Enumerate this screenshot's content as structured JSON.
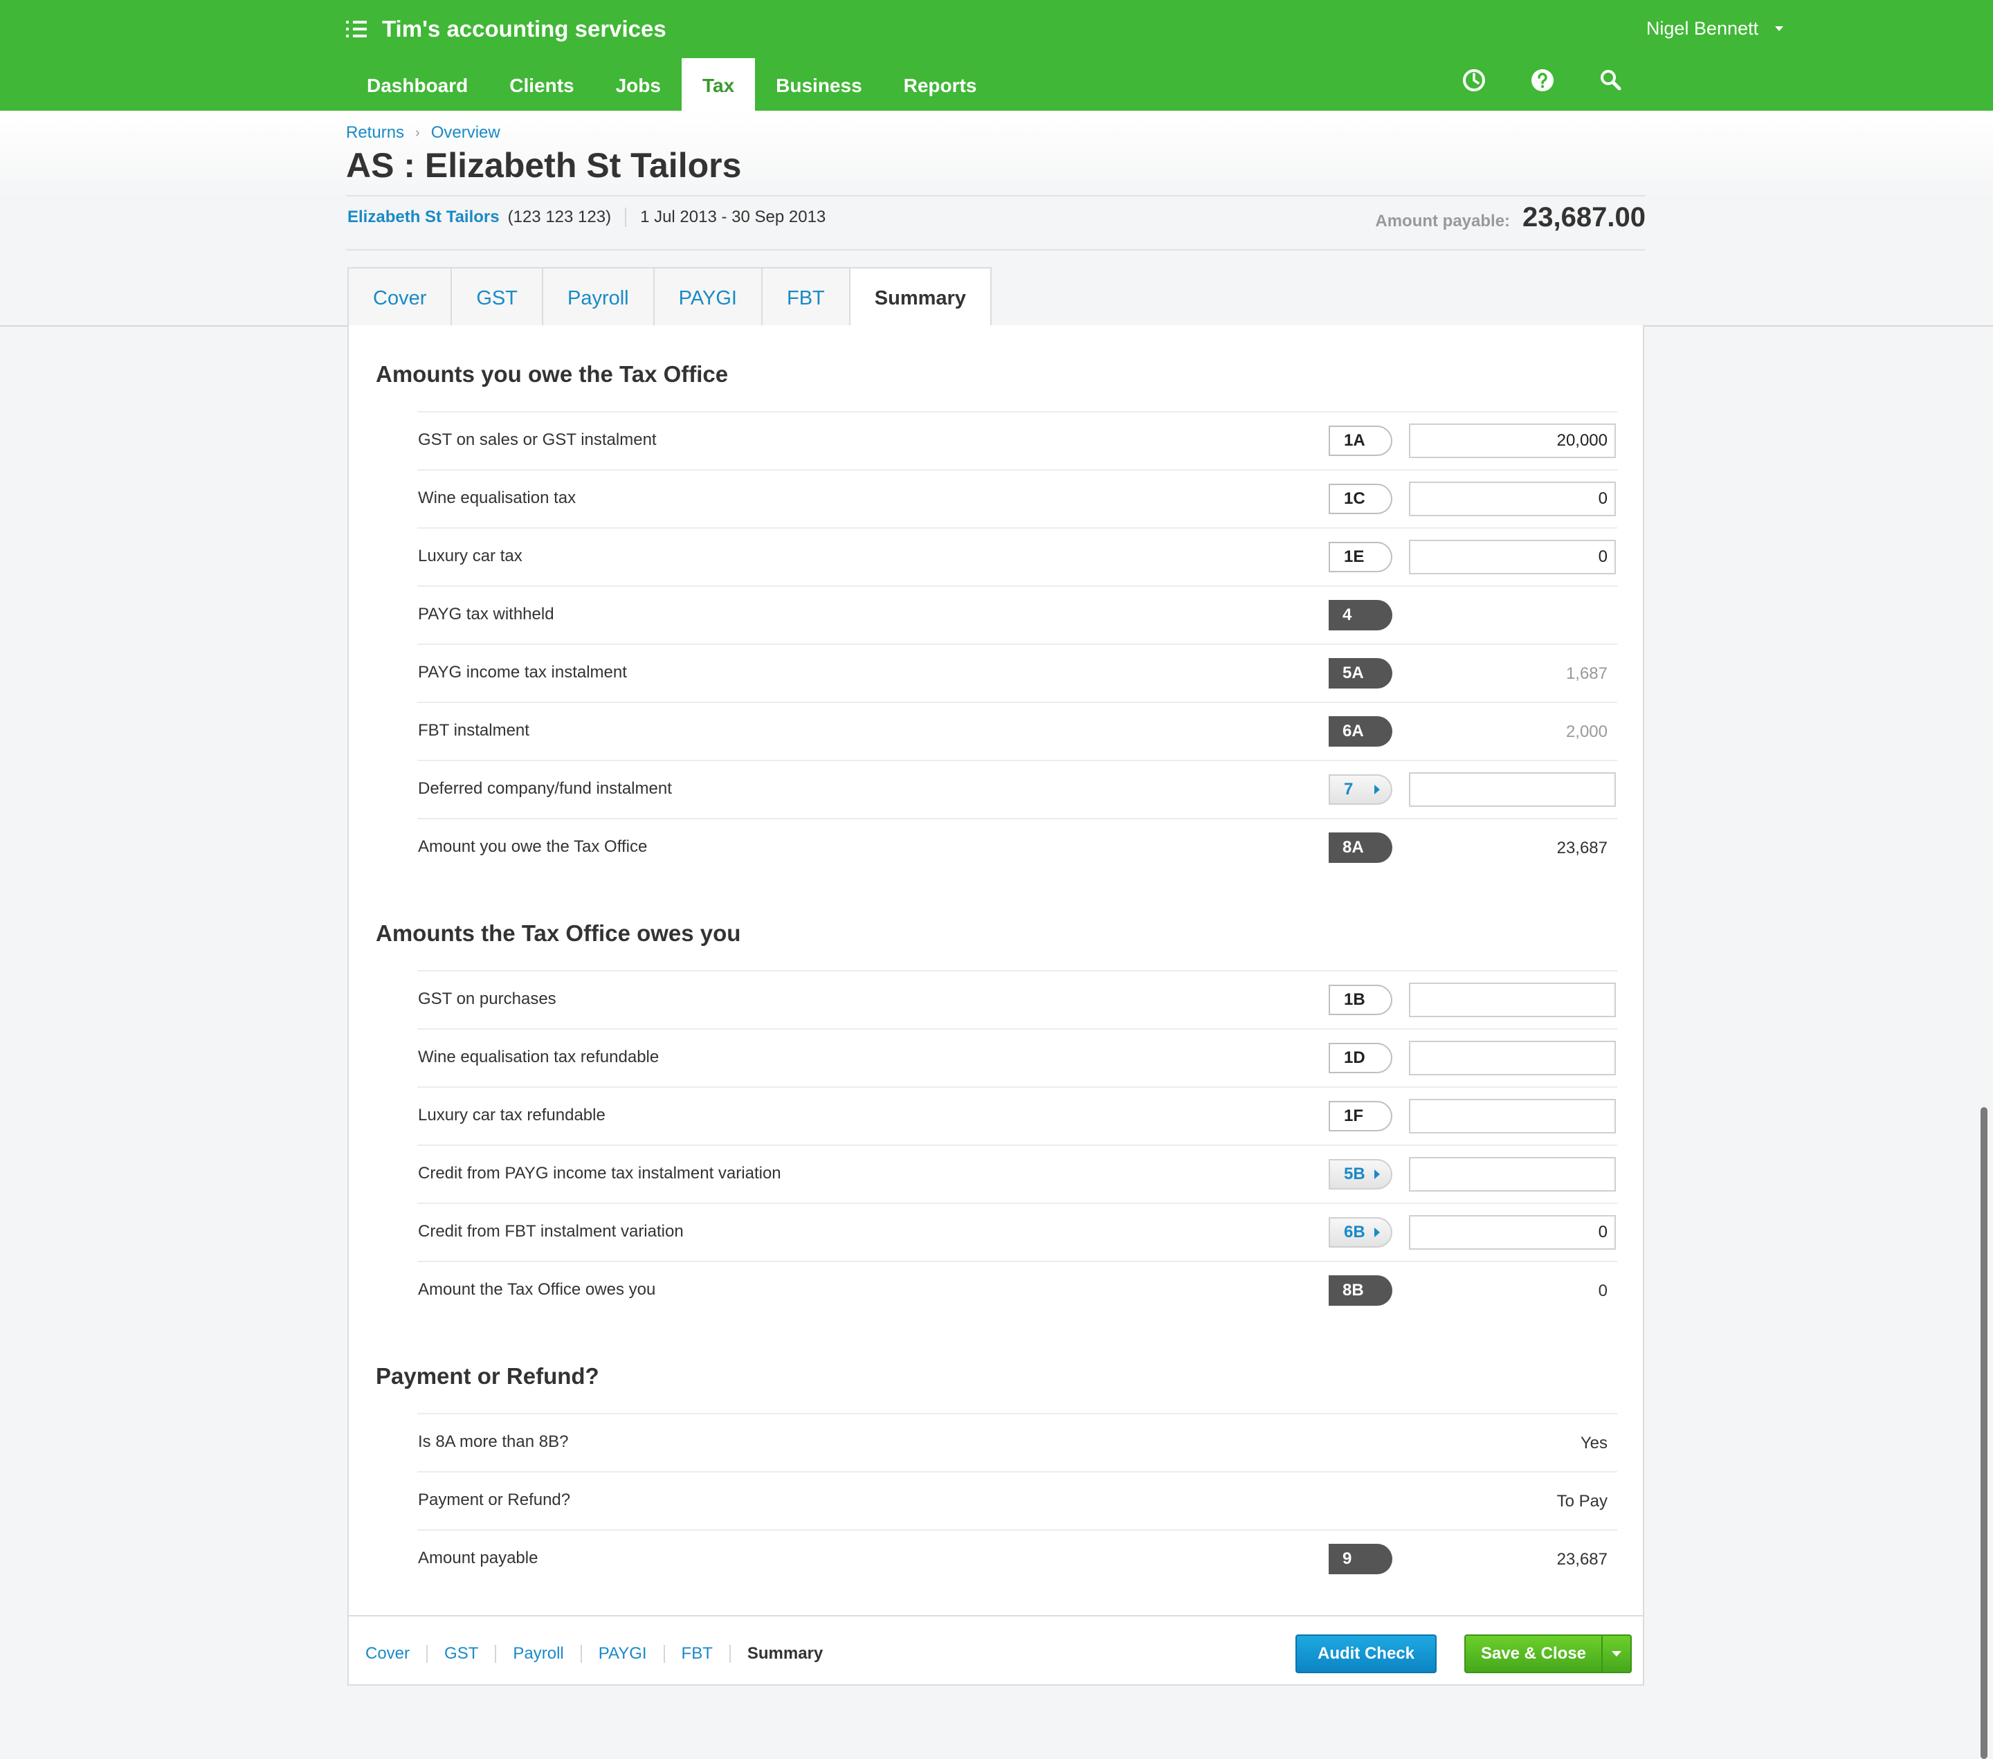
{
  "brand": {
    "title": "Tim's accounting services"
  },
  "user": {
    "name": "Nigel Bennett"
  },
  "nav": {
    "tabs": [
      "Dashboard",
      "Clients",
      "Jobs",
      "Tax",
      "Business",
      "Reports"
    ],
    "active": "Tax"
  },
  "header_icons": [
    "clock-icon",
    "help-icon",
    "search-icon"
  ],
  "breadcrumb": {
    "items": [
      "Returns",
      "Overview"
    ]
  },
  "page": {
    "title": "AS : Elizabeth St Tailors",
    "client": "Elizabeth St Tailors",
    "abn": "(123 123 123)",
    "period": "1 Jul 2013 - 30 Sep 2013",
    "amount_payable_label": "Amount payable:",
    "amount_payable_value": "23,687.00"
  },
  "tabs": {
    "items": [
      "Cover",
      "GST",
      "Payroll",
      "PAYGI",
      "FBT",
      "Summary"
    ],
    "active": "Summary"
  },
  "sections": {
    "owe": {
      "title": "Amounts you owe the Tax Office",
      "rows": [
        {
          "label": "GST on sales or GST instalment",
          "code": "1A",
          "field": "20,000"
        },
        {
          "label": "Wine equalisation tax",
          "code": "1C",
          "field": "0"
        },
        {
          "label": "Luxury car tax",
          "code": "1E",
          "field": "0"
        },
        {
          "label": "PAYG tax withheld",
          "code": "4",
          "value": ""
        },
        {
          "label": "PAYG income tax instalment",
          "code": "5A",
          "value": "1,687"
        },
        {
          "label": "FBT instalment",
          "code": "6A",
          "value": "2,000"
        },
        {
          "label": "Deferred company/fund instalment",
          "code": "7",
          "field": ""
        },
        {
          "label": "Amount you owe the Tax Office",
          "code": "8A",
          "value": "23,687"
        }
      ]
    },
    "owed": {
      "title": "Amounts the Tax Office owes you",
      "rows": [
        {
          "label": "GST on purchases",
          "code": "1B",
          "field": ""
        },
        {
          "label": "Wine equalisation tax refundable",
          "code": "1D",
          "field": ""
        },
        {
          "label": "Luxury car tax refundable",
          "code": "1F",
          "field": ""
        },
        {
          "label": "Credit from PAYG income tax instalment variation",
          "code": "5B",
          "field": ""
        },
        {
          "label": "Credit from FBT instalment variation",
          "code": "6B",
          "field": "0"
        },
        {
          "label": "Amount the Tax Office owes you",
          "code": "8B",
          "value": "0"
        }
      ]
    },
    "result": {
      "title": "Payment or Refund?",
      "rows": [
        {
          "label": "Is 8A more than 8B?",
          "value": "Yes"
        },
        {
          "label": "Payment or Refund?",
          "value": "To Pay"
        },
        {
          "label": "Amount payable",
          "code": "9",
          "value": "23,687"
        }
      ]
    }
  },
  "footer": {
    "tabs": [
      "Cover",
      "GST",
      "Payroll",
      "PAYGI",
      "FBT",
      "Summary"
    ],
    "audit_label": "Audit Check",
    "save_label": "Save & Close"
  },
  "colors": {
    "header_green": "#40b736",
    "link_blue": "#1a8ac7",
    "badge_dark": "#555555",
    "save_green": "#5cbf24",
    "audit_blue": "#1597d6"
  }
}
